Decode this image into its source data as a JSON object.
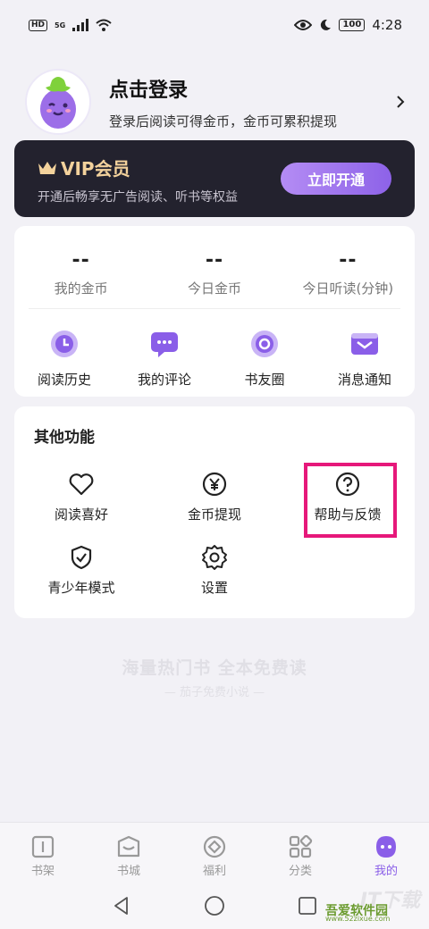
{
  "status_bar": {
    "hd": "HD",
    "network": "5G",
    "battery": "100",
    "time": "4:28"
  },
  "header": {
    "title": "点击登录",
    "subtitle": "登录后阅读可得金币，金币可累积提现"
  },
  "vip": {
    "title": "VIP会员",
    "subtitle": "开通后畅享无广告阅读、听书等权益",
    "button": "立即开通"
  },
  "stats": [
    {
      "value": "--",
      "label": "我的金币"
    },
    {
      "value": "--",
      "label": "今日金币"
    },
    {
      "value": "--",
      "label": "今日听读(分钟)"
    }
  ],
  "quick_actions": [
    {
      "label": "阅读历史",
      "icon": "clock-icon"
    },
    {
      "label": "我的评论",
      "icon": "comment-icon"
    },
    {
      "label": "书友圈",
      "icon": "circle-icon"
    },
    {
      "label": "消息通知",
      "icon": "mail-icon"
    }
  ],
  "other": {
    "title": "其他功能",
    "items": [
      {
        "label": "阅读喜好",
        "icon": "heart-icon"
      },
      {
        "label": "金币提现",
        "icon": "yen-icon"
      },
      {
        "label": "帮助与反馈",
        "icon": "help-icon"
      },
      {
        "label": "青少年模式",
        "icon": "shield-icon"
      },
      {
        "label": "设置",
        "icon": "gear-icon"
      }
    ]
  },
  "slogan": {
    "main": "海量热门书 全本免费读",
    "sub": "— 茄子免费小说 —"
  },
  "tabs": [
    {
      "label": "书架",
      "icon": "bookshelf-icon"
    },
    {
      "label": "书城",
      "icon": "bookstore-icon"
    },
    {
      "label": "福利",
      "icon": "welfare-icon"
    },
    {
      "label": "分类",
      "icon": "category-icon"
    },
    {
      "label": "我的",
      "icon": "profile-icon"
    }
  ],
  "watermark": {
    "text": "IT下载",
    "brand": "吾爱软件园",
    "site": "www.52zixue.com"
  },
  "colors": {
    "accent": "#8a5ee8",
    "highlight": "#e6187a",
    "vip_gold": "#f3d29c",
    "vip_bg": "#23222e"
  }
}
